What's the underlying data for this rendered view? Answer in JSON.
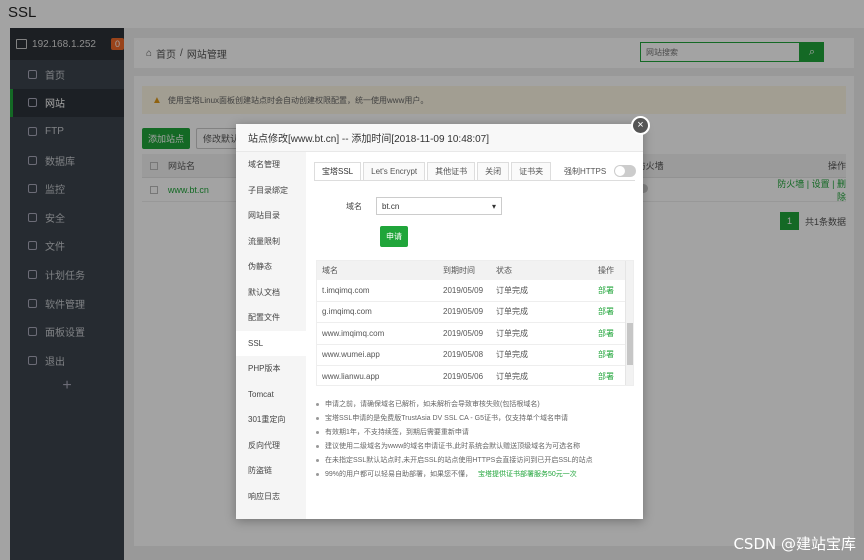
{
  "caption": "SSL",
  "sidebar": {
    "ip": "192.168.1.252",
    "badge": "0",
    "items": [
      {
        "label": "首页"
      },
      {
        "label": "网站"
      },
      {
        "label": "FTP"
      },
      {
        "label": "数据库"
      },
      {
        "label": "监控"
      },
      {
        "label": "安全"
      },
      {
        "label": "文件"
      },
      {
        "label": "计划任务"
      },
      {
        "label": "软件管理"
      },
      {
        "label": "面板设置"
      },
      {
        "label": "退出"
      }
    ],
    "add": "+"
  },
  "breadcrumb": {
    "home": "首页",
    "sep": "/",
    "current": "网站管理"
  },
  "search": {
    "placeholder": "网站搜索"
  },
  "warning": "使用宝塔Linux面板创建站点时会自动创建权限配置，统一使用www用户。",
  "toolbar": {
    "add_site": "添加站点",
    "modify_default": "修改默认页"
  },
  "site_table": {
    "col_name": "网站名",
    "col_firewall": "防火墙",
    "col_action": "操作",
    "rows": [
      {
        "name": "www.bt.cn",
        "actions": "防火墙 | 设置 | 删除"
      }
    ]
  },
  "pager": {
    "current": "1",
    "total": "共1条数据"
  },
  "modal": {
    "title": "站点修改[www.bt.cn] -- 添加时间[2018-11-09 10:48:07]",
    "close": "×",
    "side_menu": [
      "域名管理",
      "子目录绑定",
      "网站目录",
      "流量限制",
      "伪静态",
      "默认文档",
      "配置文件",
      "SSL",
      "PHP版本",
      "Tomcat",
      "301重定向",
      "反向代理",
      "防盗链",
      "响应日志"
    ],
    "tabs": [
      "宝塔SSL",
      "Let's Encrypt",
      "其他证书",
      "关闭",
      "证书夹"
    ],
    "force_https": "强制HTTPS",
    "domain_label": "域名",
    "domain_value": "bt.cn",
    "apply": "申请",
    "cert_table": {
      "headers": [
        "域名",
        "到期时间",
        "状态",
        "操作"
      ],
      "rows": [
        {
          "domain": "t.imqimq.com",
          "expire": "2019/05/09",
          "status": "订单完成",
          "action": "部署"
        },
        {
          "domain": "g.imqimq.com",
          "expire": "2019/05/09",
          "status": "订单完成",
          "action": "部署"
        },
        {
          "domain": "www.imqimq.com",
          "expire": "2019/05/09",
          "status": "订单完成",
          "action": "部署"
        },
        {
          "domain": "www.wumei.app",
          "expire": "2019/05/08",
          "status": "订单完成",
          "action": "部署"
        },
        {
          "domain": "www.lianwu.app",
          "expire": "2019/05/06",
          "status": "订单完成",
          "action": "部署"
        }
      ]
    },
    "notes": [
      "申请之前，请确保域名已解析，如未解析会导致审核失败(包括根域名)",
      "宝塔SSL申请的是免费版TrustAsia DV SSL CA - G5证书，仅支持单个域名申请",
      "有效期1年，不支持续签，到期后需要重新申请",
      "建议使用二级域名为www的域名申请证书,此时系统会默认赠送顶级域名为可选名称",
      "在未指定SSL默认站点时,未开启SSL的站点使用HTTPS会直接访问到已开启SSL的站点",
      "99%的用户都可以轻易自助部署，如果您不懂，"
    ],
    "notes_link": "宝塔提供证书部署服务50元一次"
  },
  "watermark": "CSDN @建站宝库"
}
